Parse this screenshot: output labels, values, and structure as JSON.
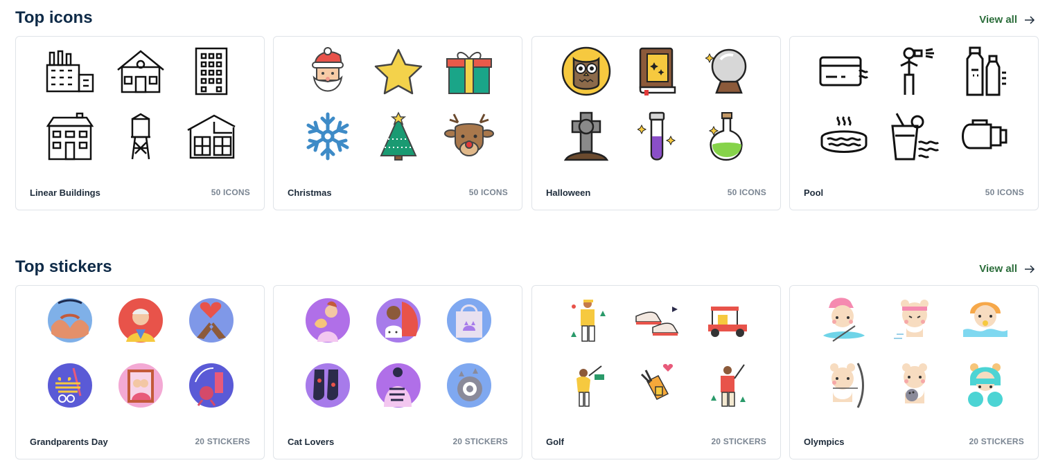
{
  "icons_section": {
    "title": "Top icons",
    "view_all": "View all",
    "cards": [
      {
        "name": "Linear Buildings",
        "count": "50 ICONS",
        "thumbs": [
          "factory-icon",
          "house-icon",
          "office-building-icon",
          "townhouse-icon",
          "water-tower-icon",
          "modern-house-icon"
        ]
      },
      {
        "name": "Christmas",
        "count": "50 ICONS",
        "thumbs": [
          "santa-icon",
          "star-icon",
          "gift-icon",
          "snowflake-icon",
          "christmas-tree-icon",
          "reindeer-icon"
        ]
      },
      {
        "name": "Halloween",
        "count": "50 ICONS",
        "thumbs": [
          "owl-icon",
          "spell-book-icon",
          "crystal-ball-icon",
          "grave-cross-icon",
          "potion-vial-icon",
          "potion-flask-icon"
        ]
      },
      {
        "name": "Pool",
        "count": "50 ICONS",
        "thumbs": [
          "credit-card-icon",
          "lifeguard-whistle-icon",
          "chemical-bottles-icon",
          "hot-tub-icon",
          "drink-glass-icon",
          "pool-pump-icon"
        ]
      }
    ]
  },
  "stickers_section": {
    "title": "Top stickers",
    "view_all": "View all",
    "cards": [
      {
        "name": "Grandparents Day",
        "count": "20 STICKERS",
        "thumbs": [
          "holding-hands-sticker",
          "grandpa-sticker",
          "heart-hands-sticker",
          "happy-grandparents-day-sticker",
          "couple-portrait-sticker",
          "love-grandma-sticker"
        ]
      },
      {
        "name": "Cat Lovers",
        "count": "20 STICKERS",
        "thumbs": [
          "cat-hug-sticker",
          "girl-cat-sticker",
          "cat-tote-bag-sticker",
          "cat-socks-sticker",
          "cat-lovers-club-sticker",
          "sleeping-cat-sticker"
        ]
      },
      {
        "name": "Golf",
        "count": "20 STICKERS",
        "thumbs": [
          "golfer-sticker",
          "golf-shoes-sticker",
          "golf-cart-sticker",
          "golf-swing-sticker",
          "golf-bag-sticker",
          "golf-player-sticker"
        ]
      },
      {
        "name": "Olympics",
        "count": "20 STICKERS",
        "thumbs": [
          "bear-rowing-sticker",
          "bear-running-sticker",
          "bear-swimming-sticker",
          "bear-archery-sticker",
          "bear-bowling-sticker",
          "bear-boxing-sticker"
        ]
      }
    ],
    "palette": {
      "purple": "#a77bea",
      "pink": "#e85a7a",
      "blue": "#7b8ff0",
      "cream": "#f7dcc0"
    }
  }
}
